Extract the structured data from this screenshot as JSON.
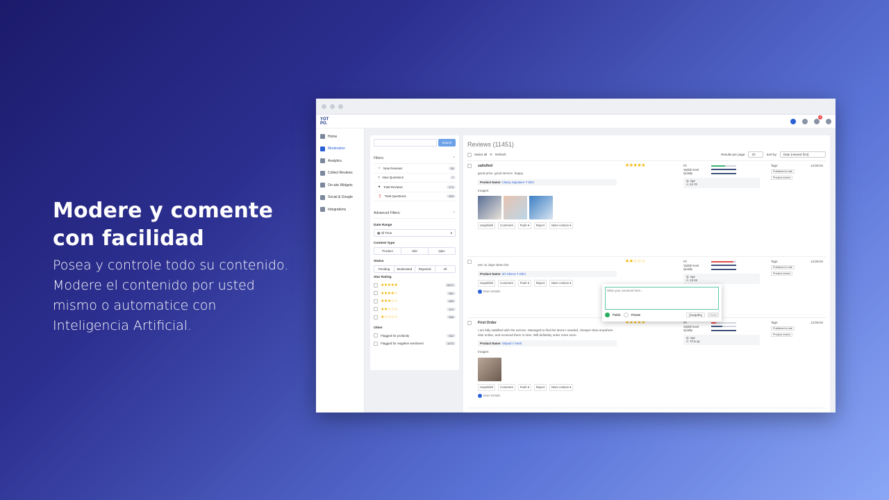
{
  "hero": {
    "title": "Modere y comente con facilidad",
    "body": "Posea y controle todo su contenido. Modere el contenido por usted mismo o automatice con Inteligencia Artificial."
  },
  "app": {
    "logo": "YOT PO.",
    "notification_count": "4",
    "nav": [
      {
        "label": "Home",
        "icon": "home-icon"
      },
      {
        "label": "Moderation",
        "icon": "moderation-icon",
        "active": true
      },
      {
        "label": "Analytics",
        "icon": "analytics-icon"
      },
      {
        "label": "Collect Reviews",
        "icon": "send-icon"
      },
      {
        "label": "On-site Widgets",
        "icon": "widgets-icon"
      },
      {
        "label": "Social & Google",
        "icon": "share-icon"
      },
      {
        "label": "Integrations",
        "icon": "integrations-icon"
      }
    ]
  },
  "filters": {
    "search_button": "Search",
    "title": "Filters:",
    "items": [
      {
        "label": "New Reviews",
        "count": "28",
        "icon": "star-outline-icon"
      },
      {
        "label": "New Questions",
        "count": "7",
        "icon": "question-icon"
      },
      {
        "label": "Total Reviews",
        "count": "174",
        "icon": "star-icon"
      },
      {
        "label": "Total Questions",
        "count": "452",
        "icon": "question-circle-icon"
      }
    ],
    "advanced_title": "Advanced Filters:",
    "date_range_label": "Date Range",
    "date_range_value": "All Time",
    "content_type_label": "Content Type",
    "content_types": [
      "Product",
      "Site",
      "Q&A"
    ],
    "status_label": "Status",
    "statuses": [
      "Pending",
      "Moderated",
      "Rejected",
      "All"
    ],
    "star_rating_label": "Star Rating",
    "star_ratings": [
      {
        "stars": "★★★★★",
        "count": "8071"
      },
      {
        "stars": "★★★★☆",
        "count": "561"
      },
      {
        "stars": "★★★☆☆",
        "count": "683"
      },
      {
        "stars": "★★☆☆☆",
        "count": "374"
      },
      {
        "stars": "★☆☆☆☆",
        "count": "566"
      }
    ],
    "other_label": "Other",
    "others": [
      {
        "label": "Flagged for profanity",
        "count": "542"
      },
      {
        "label": "Flagged for negative sentiment",
        "count": "1073"
      }
    ]
  },
  "reviews": {
    "title": "Reviews (11451)",
    "select_all": "Select all",
    "refresh": "Refresh",
    "results_label": "Results per page:",
    "results_value": "20",
    "sort_label": "Sort by:",
    "sort_value": "Date (newest first)",
    "product_name_label": "Product Name:",
    "images_label": "Images:",
    "tags_label": "Tags:",
    "tag_published": "Published to site",
    "tag_product": "Product review",
    "actions": [
      "Unpublish",
      "Comment",
      "Push ▾",
      "Reject",
      "More Actions ▾"
    ],
    "more_details": "More Details",
    "attr_labels": [
      "Fit",
      "Stylish level",
      "Quality"
    ],
    "items": [
      {
        "title": "satisfied",
        "text": "good price. good service. happy",
        "product": "Classy Signature T-Shirt",
        "stars": "★★★★★",
        "qa": "Q: Age",
        "qa_answer": "A: 41-70",
        "date": "12/25/18",
        "fit": 0.55,
        "style": 1.0,
        "quality": 1.0,
        "fit_color": "#3bb273"
      },
      {
        "title": "",
        "text": "een 11 days when the",
        "product": "3/4 Sleeve T-Shirt",
        "stars": "★★☆☆☆",
        "qa": "Q: Age",
        "qa_answer": "A: 13-18",
        "date": "12/25/18",
        "fit": 0.9,
        "style": 1.0,
        "quality": 1.0,
        "fit_color": "#e04b4b"
      },
      {
        "title": "First Order",
        "text": "I am fully satisfied with the service. Managed to find the items I needed, cheaper than anywhere else online, and received them in time. Will definitely order more soon.",
        "product": "Striped V Neck",
        "stars": "★★★★★",
        "qa": "Q: Age",
        "qa_answer": "A: 70 & up",
        "date": "12/25/18",
        "fit": 0.2,
        "style": 0.45,
        "quality": 1.0,
        "fit_color": "#e04b4b"
      }
    ]
  },
  "comment_popup": {
    "placeholder": "Write your comment here...",
    "public": "Public",
    "private": "Private",
    "personalize": "[Text|URL]",
    "post": "Post"
  },
  "colors": {
    "accent": "#2a5fd6",
    "star": "#f4b400",
    "bar_dark": "#3d4f7a"
  }
}
